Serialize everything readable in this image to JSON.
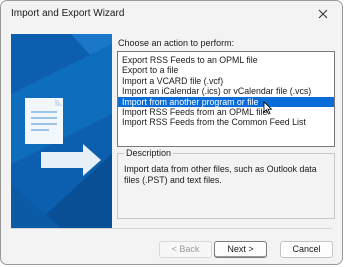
{
  "window": {
    "title": "Import and Export Wizard",
    "close_icon": "close-icon"
  },
  "main": {
    "prompt": "Choose an action to perform:",
    "actions": [
      "Export RSS Feeds to an OPML file",
      "Export to a file",
      "Import a VCARD file (.vcf)",
      "Import an iCalendar (.ics) or vCalendar file (.vcs)",
      "Import from another program or file",
      "Import RSS Feeds from an OPML file",
      "Import RSS Feeds from the Common Feed List"
    ],
    "selected_index": 4
  },
  "description": {
    "legend": "Description",
    "text": "Import data from other files, such as Outlook data files (.PST) and text files."
  },
  "buttons": {
    "back": "< Back",
    "next": "Next >",
    "cancel": "Cancel"
  },
  "colors": {
    "accent": "#0a6cd6",
    "graphic_blue": "#0b5fae"
  }
}
